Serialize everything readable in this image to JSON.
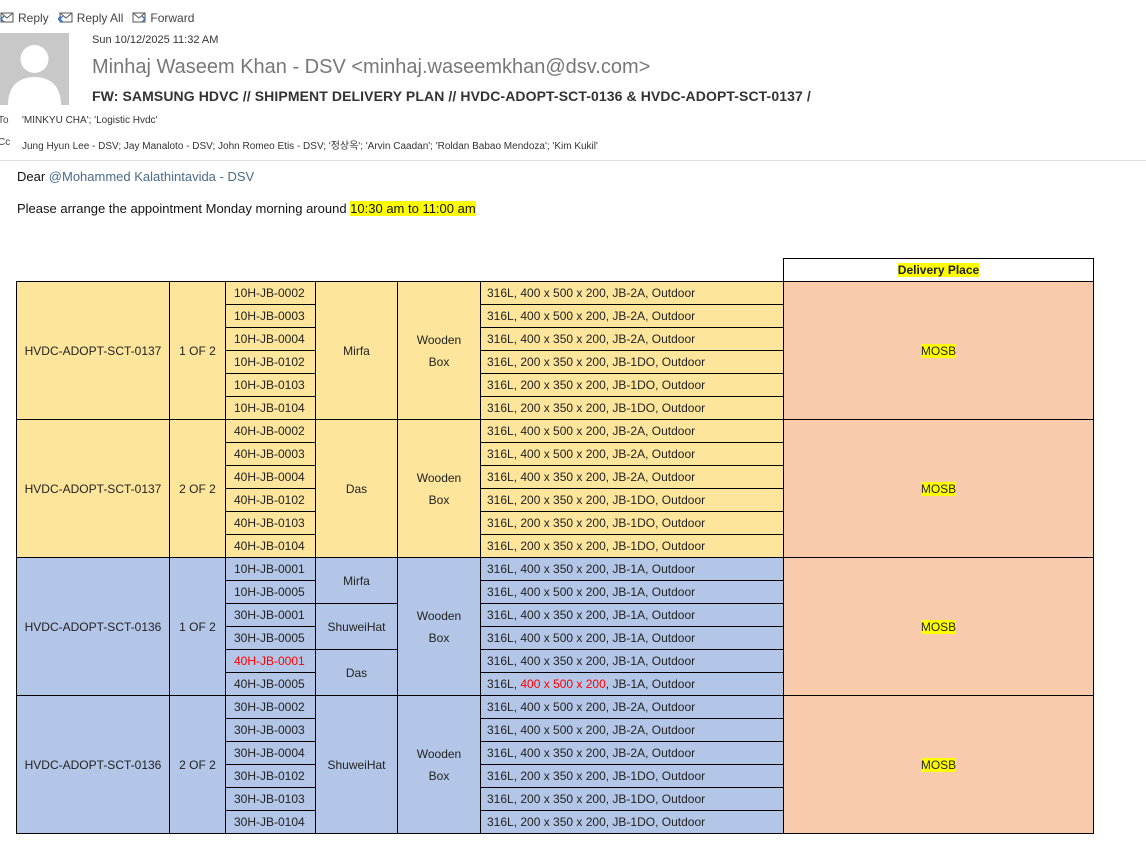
{
  "toolbar": {
    "reply": "Reply",
    "reply_all": "Reply All",
    "forward": "Forward"
  },
  "header": {
    "date": "Sun 10/12/2025 11:32 AM",
    "from": "Minhaj Waseem Khan - DSV <minhaj.waseemkhan@dsv.com>",
    "subject": "FW:  SAMSUNG HDVC // SHIPMENT DELIVERY PLAN // HVDC-ADOPT-SCT-0136 & HVDC-ADOPT-SCT-0137 /",
    "to_label": "To",
    "to": "'MINKYU CHA'; 'Logistic Hvdc'",
    "cc_label": "Cc",
    "cc": "Jung Hyun Lee - DSV; Jay Manaloto - DSV; John Romeo Etis - DSV; '정상옥'; 'Arvin Caadan'; 'Roldan Babao Mendoza'; 'Kim Kukil'"
  },
  "body": {
    "greeting": "Dear ",
    "mention": "@Mohammed Kalathintavida - DSV",
    "instruction": "Please arrange the appointment Monday morning around ",
    "time_window": "10:30 am to 11:00 am"
  },
  "table": {
    "header_place": "Delivery Place",
    "groups": [
      {
        "id": "HVDC-ADOPT-SCT-0137",
        "of": "1 OF 2",
        "packing": [
          "Wooden",
          "Box"
        ],
        "place": "MOSB",
        "sites": [
          "Mirfa"
        ],
        "items": [
          {
            "jb": "10H-JB-0002",
            "desc": "316L, 400 x 500 x 200, JB-2A, Outdoor"
          },
          {
            "jb": "10H-JB-0003",
            "desc": "316L, 400 x 500 x 200, JB-2A, Outdoor"
          },
          {
            "jb": "10H-JB-0004",
            "desc": "316L, 400 x 350 x 200, JB-2A, Outdoor"
          },
          {
            "jb": "10H-JB-0102",
            "desc": "316L, 200 x 350 x 200, JB-1DO, Outdoor"
          },
          {
            "jb": "10H-JB-0103",
            "desc": "316L, 200 x 350 x 200, JB-1DO, Outdoor"
          },
          {
            "jb": "10H-JB-0104",
            "desc": "316L, 200 x 350 x 200, JB-1DO, Outdoor"
          }
        ]
      },
      {
        "id": "HVDC-ADOPT-SCT-0137",
        "of": "2 OF 2",
        "packing": [
          "Wooden",
          "Box"
        ],
        "place": "MOSB",
        "sites": [
          "Das"
        ],
        "items": [
          {
            "jb": "40H-JB-0002",
            "desc": "316L, 400 x 500 x 200, JB-2A, Outdoor"
          },
          {
            "jb": "40H-JB-0003",
            "desc": "316L, 400 x 500 x 200, JB-2A, Outdoor"
          },
          {
            "jb": "40H-JB-0004",
            "desc": "316L, 400 x 350 x 200, JB-2A, Outdoor"
          },
          {
            "jb": "40H-JB-0102",
            "desc": "316L, 200 x 350 x 200, JB-1DO, Outdoor"
          },
          {
            "jb": "40H-JB-0103",
            "desc": "316L, 200 x 350 x 200, JB-1DO, Outdoor"
          },
          {
            "jb": "40H-JB-0104",
            "desc": "316L, 200 x 350 x 200, JB-1DO, Outdoor"
          }
        ]
      },
      {
        "id": "HVDC-ADOPT-SCT-0136",
        "of": "1 OF 2",
        "packing": [
          "Wooden",
          "Box"
        ],
        "place": "MOSB",
        "sites": [
          "Mirfa",
          "ShuweiHat",
          "Das"
        ],
        "items": [
          {
            "jb": "10H-JB-0001",
            "desc": "316L, 400 x 350 x 200, JB-1A, Outdoor"
          },
          {
            "jb": "10H-JB-0005",
            "desc": "316L, 400 x 500 x 200, JB-1A, Outdoor"
          },
          {
            "jb": "30H-JB-0001",
            "desc": "316L, 400 x 350 x 200, JB-1A, Outdoor"
          },
          {
            "jb": "30H-JB-0005",
            "desc": "316L, 400 x 500 x 200, JB-1A, Outdoor"
          },
          {
            "jb": "40H-JB-0001",
            "desc": "316L, 400 x 350 x 200, JB-1A, Outdoor"
          },
          {
            "jb": "40H-JB-0005",
            "desc_pre": "316L, ",
            "desc_red": "400 x 500 x 200",
            "desc_post": ", JB-1A, Outdoor"
          }
        ]
      },
      {
        "id": "HVDC-ADOPT-SCT-0136",
        "of": "2 OF 2",
        "packing": [
          "Wooden",
          "Box"
        ],
        "place": "MOSB",
        "sites": [
          "ShuweiHat"
        ],
        "items": [
          {
            "jb": "30H-JB-0002",
            "desc": "316L, 400 x 500 x 200, JB-2A, Outdoor"
          },
          {
            "jb": "30H-JB-0003",
            "desc": "316L, 400 x 500 x 200, JB-2A, Outdoor"
          },
          {
            "jb": "30H-JB-0004",
            "desc": "316L, 400 x 350 x 200, JB-2A, Outdoor"
          },
          {
            "jb": "30H-JB-0102",
            "desc": "316L, 200 x 350 x 200, JB-1DO, Outdoor"
          },
          {
            "jb": "30H-JB-0103",
            "desc": "316L, 200 x 350 x 200, JB-1DO, Outdoor"
          },
          {
            "jb": "30H-JB-0104",
            "desc": "316L, 200 x 350 x 200, JB-1DO, Outdoor"
          }
        ]
      }
    ]
  },
  "colors": {
    "group_yellow": "#fde69c",
    "group_blue": "#b4c6e7",
    "place_bg": "#f8cbad",
    "highlight": "#ffff00",
    "alert_red": "#ff0000"
  }
}
